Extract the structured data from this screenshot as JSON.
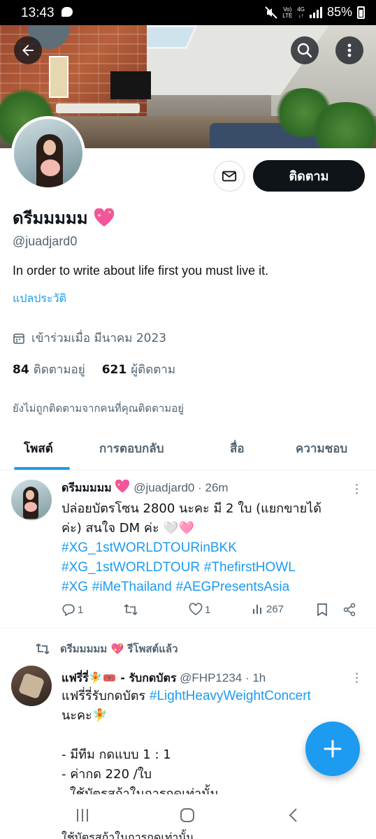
{
  "status_bar": {
    "time": "13:43",
    "network_top": "Vo)",
    "network_bottom": "LTE",
    "data_top": "4G",
    "data_bottom": "↓↑",
    "battery": "85%"
  },
  "profile": {
    "display_name": "ดรีมมมมม",
    "name_emoji": "sparkling-heart-icon",
    "handle": "@juadjard0",
    "bio": "In order to write about life first you must live it.",
    "translate_bio": "แปลประวัติ",
    "joined": "เข้าร่วมเมื่อ มีนาคม 2023",
    "following_count": "84",
    "following_label": "ติดตามอยู่",
    "followers_count": "621",
    "followers_label": "ผู้ติดตาม",
    "not_followed_note": "ยังไม่ถูกติดตามจากคนที่คุณติดตามอยู่",
    "follow_button": "ติดตาม"
  },
  "tabs": [
    {
      "label": "โพสต์",
      "active": true
    },
    {
      "label": "การตอบกลับ",
      "active": false
    },
    {
      "label": "สื่อ",
      "active": false
    },
    {
      "label": "ความชอบ",
      "active": false
    }
  ],
  "tweets": [
    {
      "author": "ดรีมมมมม",
      "handle": "@juadjard0",
      "time": "· 26m",
      "text_line1": "ปล่อยบัตรโซน 2800 นะคะ มี 2 ใบ (แยกขายได้",
      "text_line2": "ค่ะ) สนใจ DM ค่ะ 🤍🩷",
      "hashtags": [
        "#XG_1stWORLDTOURinBKK",
        "#XG_1stWORLDTOUR",
        "#ThefirstHOWL",
        "#XG",
        "#iMeThailand",
        "#AEGPresentsAsia"
      ],
      "replies": "1",
      "retweets": "",
      "likes": "1",
      "views": "267"
    },
    {
      "retweeted_by": "ดรีมมมมม 💖 รีโพสต์แล้ว",
      "author": "แฟรี่รี่🧚🎟️ - รับกดบัตร",
      "handle": "@FHP1234",
      "time": "· 1h",
      "text_line1_prefix": "แฟรี่รี่รับกดบัตร",
      "text_line1_tag": "#LightHeavyWeightConcert",
      "text_line2": "นะคะ🧚",
      "bullet1": "- มีทีม กดแบบ 1 : 1",
      "bullet2": "- ค่ากด 220 /ใบ",
      "bullet3_partial": "ใช้บัตรสถ้าในการกดเท่านั้น",
      "overflow_line": "ใช้บัตรสถ้าในการกดเท่านั้น"
    }
  ],
  "colors": {
    "accent": "#1d9bf0",
    "text_primary": "#0f1419",
    "text_secondary": "#536471",
    "follow_button_bg": "#0f1419",
    "heart_pink": "#f2559b"
  }
}
